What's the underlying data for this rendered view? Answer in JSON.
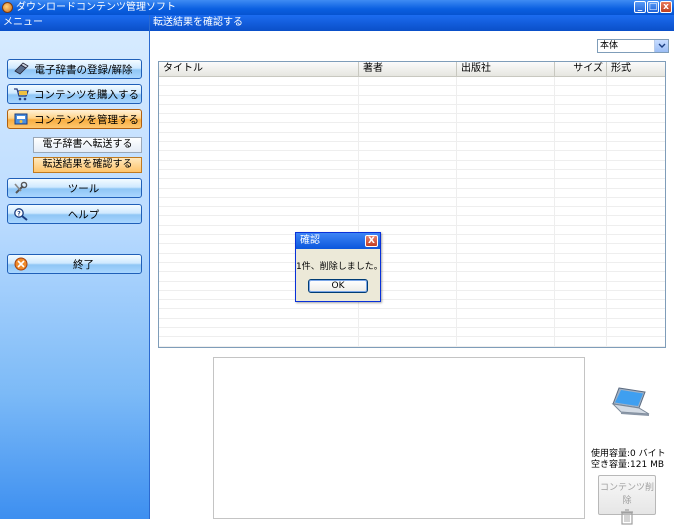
{
  "window": {
    "title": "ダウンロードコンテンツ管理ソフト",
    "minimize": "_",
    "maximize": "□",
    "close": "x"
  },
  "sidebar": {
    "header": "メニュー",
    "items": [
      {
        "label": "電子辞書の登録/解除",
        "icon": "dictionary-register-icon"
      },
      {
        "label": "コンテンツを購入する",
        "icon": "cart-icon"
      },
      {
        "label": "コンテンツを管理する",
        "icon": "manage-icon"
      },
      {
        "label": "ツール",
        "icon": "tools-icon"
      },
      {
        "label": "ヘルプ",
        "icon": "help-magnifier-icon"
      },
      {
        "label": "終了",
        "icon": "exit-icon"
      }
    ],
    "subitems": [
      {
        "label": "電子辞書へ転送する"
      },
      {
        "label": "転送結果を確認する"
      }
    ]
  },
  "main": {
    "header": "転送結果を確認する",
    "storage_select": "本体",
    "columns": [
      "タイトル",
      "著者",
      "出版社",
      "サイズ",
      "形式"
    ],
    "usage": {
      "used_label": "使用容量:",
      "used_value": "0 バイト",
      "free_label": "空き容量:",
      "free_value": "121 MB"
    },
    "delete_button": "コンテンツ削除"
  },
  "dialog": {
    "title": "確認",
    "message": "1件、削除しました。",
    "ok": "OK",
    "close": "X"
  },
  "colors": {
    "accent": "#0a5fe0",
    "active_menu": "#f8ad40",
    "sidebar_bottom": "#3d8ff0"
  }
}
